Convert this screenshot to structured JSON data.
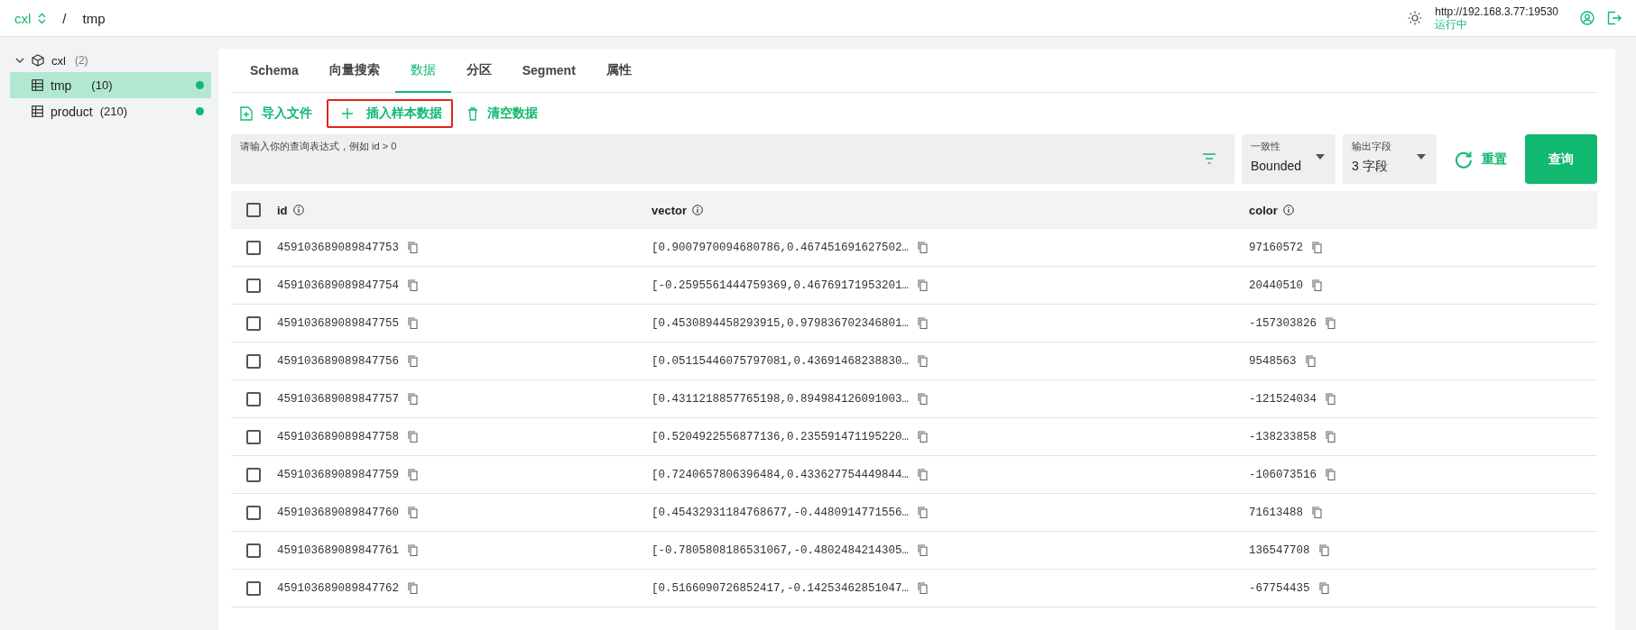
{
  "header": {
    "database": "cxl",
    "separator": "/",
    "collection": "tmp",
    "server_url": "http://192.168.3.77:19530",
    "status": "运行中"
  },
  "sidebar": {
    "tree": [
      {
        "label": "cxl",
        "count": "(2)",
        "expanded": true,
        "children": [
          {
            "label": "tmp",
            "count": "(10)",
            "selected": true,
            "color": "#10b870"
          },
          {
            "label": "product",
            "count": "(210)",
            "selected": false,
            "color": "#10b870"
          }
        ]
      }
    ]
  },
  "tabs": [
    {
      "label": "Schema",
      "selected": false
    },
    {
      "label": "向量搜索",
      "selected": false
    },
    {
      "label": "数据",
      "selected": true
    },
    {
      "label": "分区",
      "selected": false
    },
    {
      "label": "Segment",
      "selected": false
    },
    {
      "label": "属性",
      "selected": false
    }
  ],
  "actions": [
    {
      "kind": "import",
      "label": "导入文件",
      "highlighted": false
    },
    {
      "kind": "insert",
      "label": "插入样本数据",
      "highlighted": true
    },
    {
      "kind": "clear",
      "label": "清空数据",
      "highlighted": false
    }
  ],
  "query": {
    "placeholder": "请输入你的查询表达式，例如 id > 0",
    "consistency": {
      "label": "一致性",
      "value": "Bounded"
    },
    "output_fields": {
      "label": "输出字段",
      "value": "3 字段"
    },
    "reset": "重置",
    "submit": "查询"
  },
  "table": {
    "all_checked": false,
    "columns": [
      "id",
      "vector",
      "color"
    ],
    "rows": [
      {
        "checked": false,
        "cells": [
          "459103689089847753",
          "[0.9007970094680786,0.467451691627502…",
          "97160572"
        ]
      },
      {
        "checked": false,
        "cells": [
          "459103689089847754",
          "[-0.2595561444759369,0.46769171953201…",
          "20440510"
        ]
      },
      {
        "checked": false,
        "cells": [
          "459103689089847755",
          "[0.4530894458293915,0.979836702346801…",
          "-157303826"
        ]
      },
      {
        "checked": false,
        "cells": [
          "459103689089847756",
          "[0.05115446075797081,0.43691468238830…",
          "9548563"
        ]
      },
      {
        "checked": false,
        "cells": [
          "459103689089847757",
          "[0.4311218857765198,0.894984126091003…",
          "-121524034"
        ]
      },
      {
        "checked": false,
        "cells": [
          "459103689089847758",
          "[0.5204922556877136,0.235591471195220…",
          "-138233858"
        ]
      },
      {
        "checked": false,
        "cells": [
          "459103689089847759",
          "[0.7240657806396484,0.433627754449844…",
          "-106073516"
        ]
      },
      {
        "checked": false,
        "cells": [
          "459103689089847760",
          "[0.45432931184768677,-0.4480914771556…",
          "71613488"
        ]
      },
      {
        "checked": false,
        "cells": [
          "459103689089847761",
          "[-0.7805808186531067,-0.4802484214305…",
          "136547708"
        ]
      },
      {
        "checked": false,
        "cells": [
          "459103689089847762",
          "[0.5166090726852417,-0.14253462851047…",
          "-67754435"
        ]
      }
    ]
  }
}
